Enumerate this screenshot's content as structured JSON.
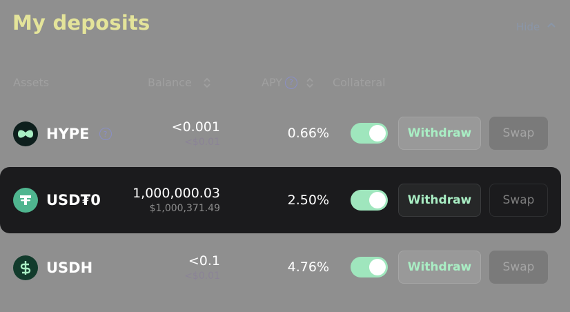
{
  "header": {
    "title": "My deposits",
    "hide_label": "Hide"
  },
  "columns": {
    "assets": "Assets",
    "balance": "Balance",
    "apy": "APY",
    "apy_help": "?",
    "collateral": "Collateral"
  },
  "rows": [
    {
      "name": "HYPE",
      "balance": "<0.001",
      "balance_usd": "<$0.01",
      "apy": "0.66%",
      "collateral": true,
      "withdraw_label": "Withdraw",
      "swap_label": "Swap",
      "help": "?",
      "logo_color": "#0e1f1d"
    },
    {
      "name": "USD₮0",
      "balance": "1,000,000.03",
      "balance_usd": "$1,000,371.49",
      "apy": "2.50%",
      "collateral": true,
      "withdraw_label": "Withdraw",
      "swap_label": "Swap",
      "logo_color": "#4fb58f"
    },
    {
      "name": "USDH",
      "balance": "<0.1",
      "balance_usd": "<$0.01",
      "apy": "4.76%",
      "collateral": true,
      "withdraw_label": "Withdraw",
      "swap_label": "Swap",
      "logo_color": "#123b2c"
    }
  ],
  "colors": {
    "accent_title": "#e4e49a",
    "toggle_on": "#9fe6bd",
    "withdraw_text": "#a9eec4"
  }
}
